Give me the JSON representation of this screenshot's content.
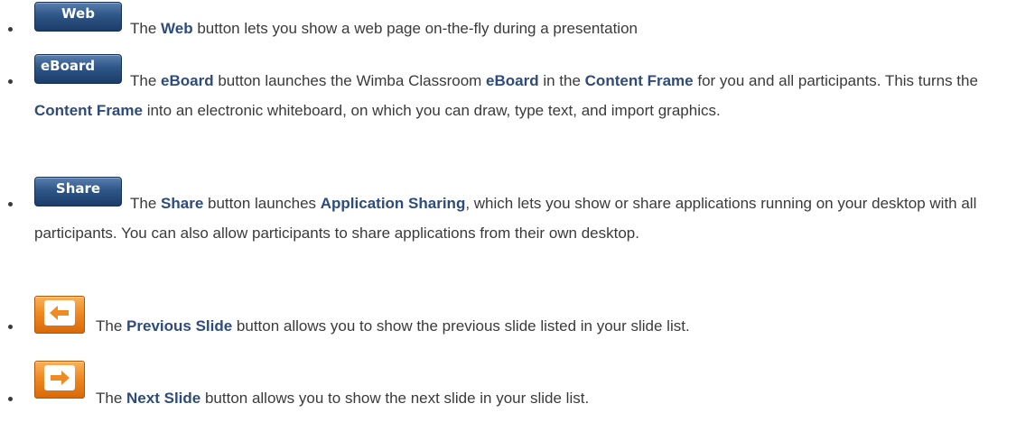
{
  "items": [
    {
      "button_label": "Web",
      "before": "The ",
      "bold1": "Web",
      "after1": " button lets you show a web page on-the-fly during a presentation",
      "bold2": "",
      "after2": "",
      "bold3": "",
      "after3": "",
      "bold4": "",
      "after4": ""
    },
    {
      "button_label": "eBoard",
      "before": "The ",
      "bold1": "eBoard",
      "after1": " button launches the Wimba Classroom ",
      "bold2": "eBoard",
      "after2": " in the ",
      "bold3": "Content Frame",
      "after3": " for you and all participants. This turns the ",
      "bold4": "Content Frame",
      "after4": " into an electronic whiteboard, on which you can draw, type text, and import graphics."
    },
    {
      "button_label": "Share",
      "before": "The ",
      "bold1": "Share",
      "after1": " button launches ",
      "bold2": "Application Sharing",
      "after2": ", which lets you show or share applications running on your desktop with all participants. You can also allow participants to share applications from their own desktop.",
      "bold3": "",
      "after3": "",
      "bold4": "",
      "after4": ""
    },
    {
      "icon": "previous-slide-arrow-icon",
      "before": "The ",
      "bold1": "Previous Slide",
      "after1": " button allows you to show the previous slide listed in your slide list.",
      "bold2": "",
      "after2": "",
      "bold3": "",
      "after3": "",
      "bold4": "",
      "after4": ""
    },
    {
      "icon": "next-slide-arrow-icon",
      "before": "The ",
      "bold1": "Next Slide",
      "after1": " button allows you to show the next slide in your slide list.",
      "bold2": "",
      "after2": "",
      "bold3": "",
      "after3": "",
      "bold4": "",
      "after4": ""
    }
  ],
  "colors": {
    "text": "#3a3a3a",
    "bold_text": "#2e4b7c",
    "blue_button": "#2e5687",
    "orange_button": "#f08a22"
  }
}
